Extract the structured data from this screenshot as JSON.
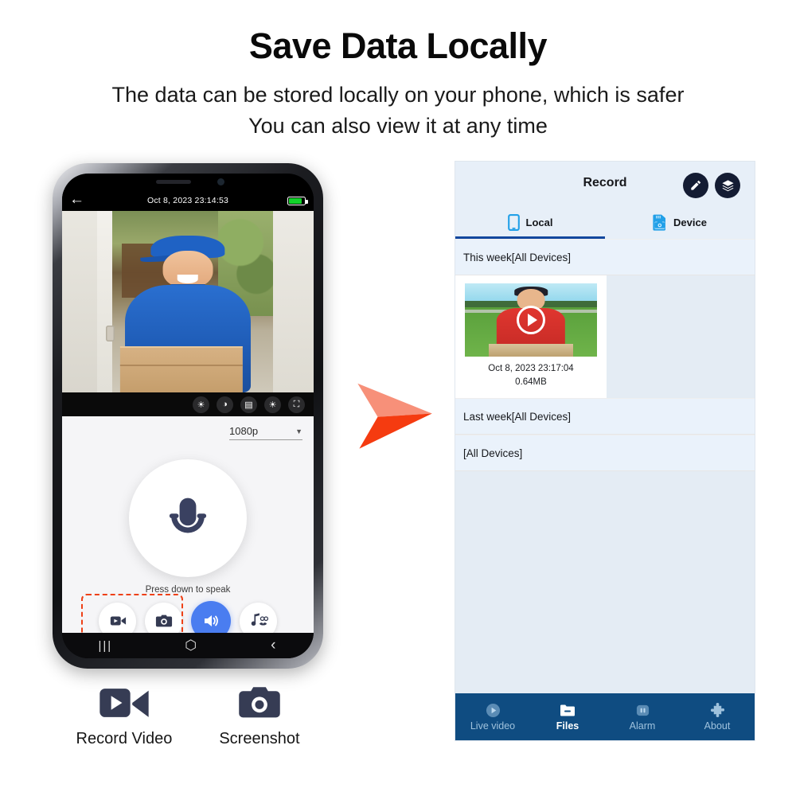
{
  "header": {
    "title": "Save Data Locally",
    "subtitle_line1": "The data can be stored locally on your phone, which is safer",
    "subtitle_line2": "You can also view it at any time"
  },
  "phone": {
    "status_bar": {
      "back_icon": "back-arrow-icon",
      "timestamp": "Oct 8, 2023 23:14:53",
      "battery_icon": "battery-full-icon"
    },
    "video_controls": [
      {
        "name": "brightness-icon",
        "glyph": "☀"
      },
      {
        "name": "contrast-icon",
        "glyph": "◑"
      },
      {
        "name": "saturation-icon",
        "glyph": "▤"
      },
      {
        "name": "exposure-icon",
        "glyph": "☀"
      },
      {
        "name": "fullscreen-icon",
        "glyph": "⛶"
      }
    ],
    "quality": {
      "value": "1080p",
      "chevron": "▼"
    },
    "mic_icon": "microphone-icon",
    "press_label": "Press down to speak",
    "action_buttons": [
      {
        "name": "record-video-button",
        "icon": "video-camera-icon",
        "highlighted": true,
        "active": false
      },
      {
        "name": "screenshot-button",
        "icon": "camera-icon",
        "highlighted": true,
        "active": false
      },
      {
        "name": "speaker-button",
        "icon": "speaker-icon",
        "highlighted": false,
        "active": true
      },
      {
        "name": "voice-changer-button",
        "icon": "voice-changer-icon",
        "highlighted": false,
        "active": false
      }
    ],
    "android_nav": [
      {
        "name": "recents-button",
        "glyph": "|||"
      },
      {
        "name": "home-button",
        "glyph": "⬡"
      },
      {
        "name": "back-button",
        "glyph": "‹"
      }
    ]
  },
  "legend": [
    {
      "icon": "video-camera-icon",
      "label": "Record Video"
    },
    {
      "icon": "camera-icon",
      "label": "Screenshot"
    }
  ],
  "arrow": {
    "name": "pointer-arrow",
    "color_light": "#f79079",
    "color_dark": "#f53b10"
  },
  "app": {
    "title": "Record",
    "header_buttons": [
      {
        "name": "edit-button",
        "icon": "pencil-icon"
      },
      {
        "name": "layers-button",
        "icon": "layers-icon"
      }
    ],
    "tabs": [
      {
        "label": "Local",
        "icon": "phone-icon",
        "active": true
      },
      {
        "label": "Device",
        "icon": "sd-card-icon",
        "active": false
      }
    ],
    "sections": [
      {
        "header": "This week[All Devices]",
        "items": [
          {
            "timestamp": "Oct 8, 2023 23:17:04",
            "size": "0.64MB",
            "play_icon": "play-icon"
          }
        ]
      },
      {
        "header": "Last week[All Devices]",
        "items": []
      },
      {
        "header": "[All Devices]",
        "items": []
      }
    ],
    "bottom_nav": [
      {
        "label": "Live video",
        "icon": "live-video-icon",
        "active": false
      },
      {
        "label": "Files",
        "icon": "folder-icon",
        "active": true
      },
      {
        "label": "Alarm",
        "icon": "alarm-icon",
        "active": false
      },
      {
        "label": "About",
        "icon": "puzzle-icon",
        "active": false
      }
    ],
    "colors": {
      "nav_bar": "#0f4c81",
      "accent": "#12479e",
      "tab_icon": "#22a0e8",
      "panel_bg": "#e4ecf4"
    }
  }
}
